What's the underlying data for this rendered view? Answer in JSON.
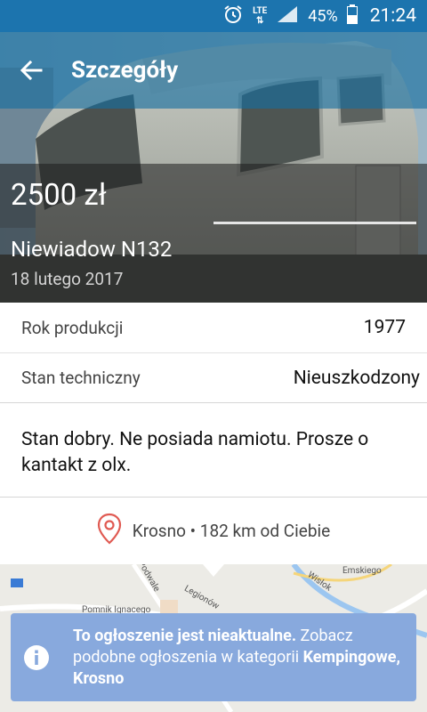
{
  "status_bar": {
    "network": "LTE",
    "battery": "45%",
    "time": "21:24"
  },
  "app_bar": {
    "title": "Szczegóły"
  },
  "listing": {
    "price": "2500 zł",
    "name": "Niewiadow N132",
    "date": "18 lutego 2017"
  },
  "details": [
    {
      "label": "Rok produkcji",
      "value": "1977"
    },
    {
      "label": "Stan techniczny",
      "value": "Nieuszkodzony"
    }
  ],
  "description": "Stan dobry.  Ne posiada namiotu.  Prosze o kantakt z olx.",
  "location": {
    "text": "Krosno • 182 km od Ciebie"
  },
  "map": {
    "labels": [
      "Podwale",
      "Pomnik Ignacego",
      "Legionów",
      "Wisłok",
      "Emskiego"
    ]
  },
  "notice": {
    "bold_lead": "To ogłoszenie jest nieaktualne.",
    "middle": " Zobacz podobne ogłoszenia w kategorii ",
    "bold_tail": "Kempingowe, Krosno"
  },
  "colors": {
    "status_bar": "#1c74ae",
    "app_bar": "#156ea0",
    "banner": "#88a9dd",
    "pin": "#e05a52"
  }
}
